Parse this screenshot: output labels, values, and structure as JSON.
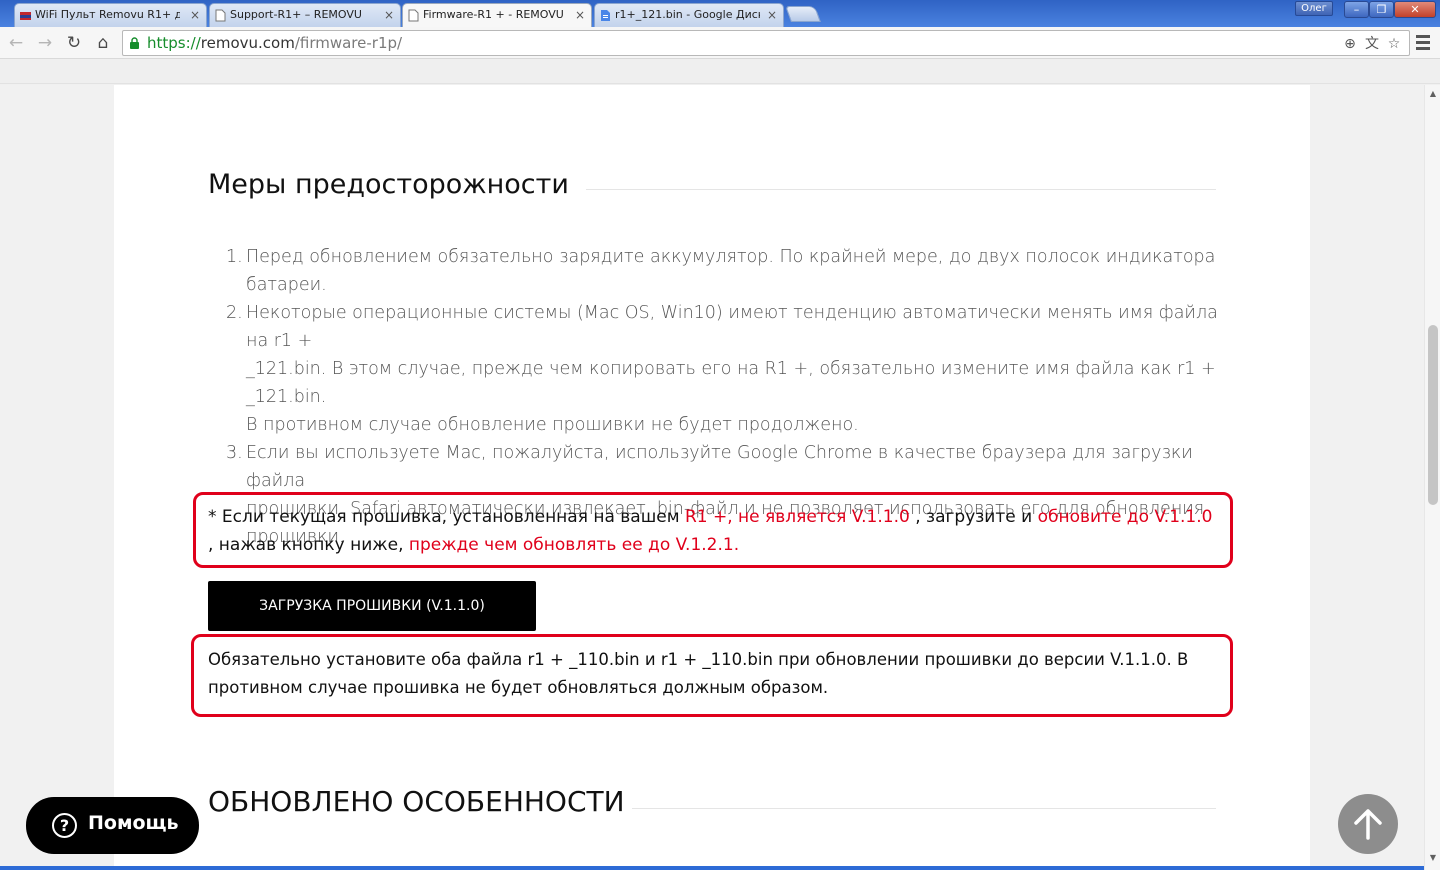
{
  "tabs": [
    {
      "title": "WiFi Пульт Removu R1+ дл",
      "active": false
    },
    {
      "title": "Support-R1+ – REMOVU",
      "active": false
    },
    {
      "title": "Firmware-R1 + - REMOVU",
      "active": true
    },
    {
      "title": "r1+_121.bin - Google Диск",
      "active": false
    }
  ],
  "window": {
    "user": "Олег"
  },
  "address": {
    "scheme": "https://",
    "host": "removu.com",
    "path": "/firmware-r1p/"
  },
  "page": {
    "precautions_title": "Меры предосторожности",
    "precautions": [
      {
        "num": "1.",
        "lines": [
          "Перед обновлением обязательно зарядите аккумулятор. По крайней мере, до двух полосок индикатора",
          "батареи."
        ]
      },
      {
        "num": "2.",
        "lines": [
          "Некоторые операционные системы (Mac OS, Win10) имеют тенденцию автоматически менять имя файла на r1 +",
          "_121.bin. В этом случае, прежде чем копировать его на R1 +, обязательно измените имя файла как r1 + _121.bin.",
          "В противном случае обновление прошивки не будет продолжено."
        ]
      },
      {
        "num": "3.",
        "lines": [
          "Если вы используете Mac, пожалуйста, используйте Google Chrome в качестве браузера для загрузки файла",
          "прошивки. Safari автоматически извлекает .bin-файл и не позволяет использовать его для обновления",
          "прошивки."
        ]
      }
    ],
    "notice1": {
      "p1": "* Если текущая прошивка, установленная на вашем ",
      "r1": "R1 +, не является V.1.1.0",
      "p2": " , загрузите и ",
      "r2": "обновите до V.1.1.0",
      "p3": ", нажав кнопку ниже, ",
      "r3": "прежде чем обновлять ее до V.1.2.1."
    },
    "download_button": "ЗАГРУЗКА ПРОШИВКИ (V.1.1.0)",
    "notice2": {
      "line1": "Обязательно установите оба файла r1 + _110.bin и r1 + _110.bin при обновлении прошивки до версии V.1.1.0. В",
      "line2": "противном случае прошивка не будет обновляться должным образом."
    },
    "features_title": "ОБНОВЛЕНО ОСОБЕННОСТИ"
  },
  "help_widget": {
    "label": "Помощь"
  },
  "colors": {
    "accent_red": "#e0001b",
    "button_bg": "#000000",
    "link_green": "#168d2c"
  }
}
